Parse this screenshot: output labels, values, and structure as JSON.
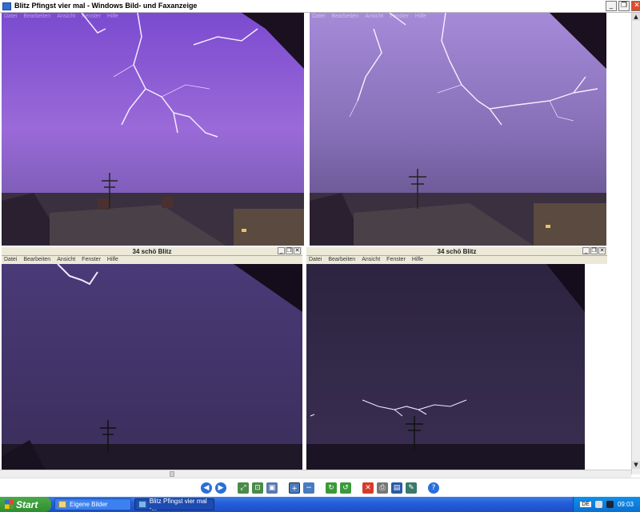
{
  "app": {
    "title": "Blitz Pfingst vier mal - Windows Bild- und Faxanzeige"
  },
  "window_controls": {
    "minimize": "_",
    "maximize": "❐",
    "close": "✕"
  },
  "child_windows": [
    {
      "id": "top-left",
      "title": "",
      "menu": [
        "Datei",
        "Bearbeiten",
        "Ansicht",
        "Fenster",
        "Hilfe"
      ]
    },
    {
      "id": "top-right",
      "title": "",
      "menu": [
        "Datei",
        "Bearbeiten",
        "Ansicht",
        "Fenster",
        "Hilfe"
      ]
    },
    {
      "id": "bottom-left",
      "title": "34 schö Blitz",
      "menu": [
        "Datei",
        "Bearbeiten",
        "Ansicht",
        "Fenster",
        "Hilfe"
      ]
    },
    {
      "id": "bottom-right",
      "title": "34 schö Blitz",
      "menu": [
        "Datei",
        "Bearbeiten",
        "Ansicht",
        "Fenster",
        "Hilfe"
      ]
    }
  ],
  "toolbar": {
    "buttons": [
      "previous-image",
      "next-image",
      "best-fit",
      "actual-size",
      "slideshow",
      "zoom-in",
      "zoom-out",
      "rotate-clockwise",
      "rotate-counterclockwise",
      "delete",
      "print",
      "copy-to",
      "edit",
      "help"
    ]
  },
  "taskbar": {
    "start_label": "Start",
    "tasks": [
      "Eigene Bilder",
      "Blitz Pfingst vier mal -..."
    ],
    "language": "DE",
    "clock": "09:03"
  },
  "colors": {
    "sky_top_left": "#8a55c8",
    "sky_top_right": "#8e6fc0",
    "sky_bottom": "#3a2e5a",
    "taskbar": "#245edb",
    "start_green": "#3a9a3a"
  }
}
